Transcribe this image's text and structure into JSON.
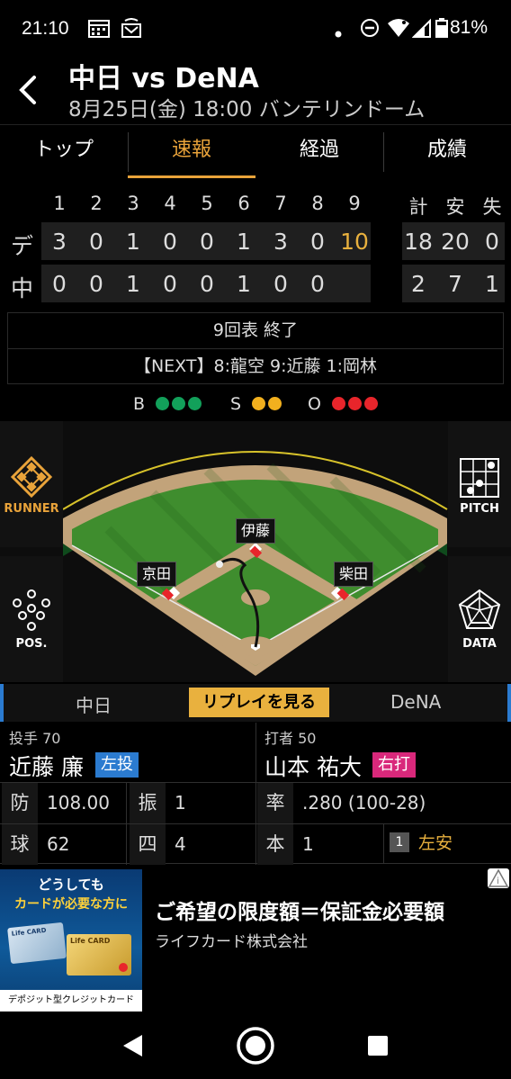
{
  "status_bar": {
    "time": "21:10",
    "battery": "81%",
    "icons": [
      "calendar-icon",
      "cast-icon",
      "dot-icon",
      "dnd-icon",
      "wifi-icon",
      "signal-icon",
      "battery-icon"
    ]
  },
  "header": {
    "title": "中日 vs DeNA",
    "subtitle": "8月25日(金) 18:00 バンテリンドーム"
  },
  "tabs": [
    {
      "label": "トップ",
      "active": false
    },
    {
      "label": "速報",
      "active": true
    },
    {
      "label": "経過",
      "active": false
    },
    {
      "label": "成績",
      "active": false
    }
  ],
  "scoreboard": {
    "innings": [
      "1",
      "2",
      "3",
      "4",
      "5",
      "6",
      "7",
      "8",
      "9"
    ],
    "totals_headers": [
      "計",
      "安",
      "失"
    ],
    "teams": [
      {
        "name": "デ",
        "runs": [
          "3",
          "0",
          "1",
          "0",
          "0",
          "1",
          "3",
          "0",
          "10"
        ],
        "totals": [
          "18",
          "20",
          "0"
        ]
      },
      {
        "name": "中",
        "runs": [
          "0",
          "0",
          "1",
          "0",
          "0",
          "1",
          "0",
          "0",
          ""
        ],
        "totals": [
          "2",
          "7",
          "1"
        ]
      }
    ]
  },
  "game_status": {
    "state": "9回表 終了",
    "next": "【NEXT】8:龍空 9:近藤 1:岡林"
  },
  "count": {
    "balls_label": "B",
    "strikes_label": "S",
    "outs_label": "O",
    "balls": 3,
    "strikes": 2,
    "outs": 3,
    "colors": {
      "ball": "#12a05a",
      "strike": "#f2b01e",
      "out": "#e8252b"
    }
  },
  "field": {
    "runner_label": "RUNNER",
    "pitch_label": "PITCH",
    "pos_label": "POS.",
    "data_label": "DATA",
    "fielders": [
      {
        "name": "伊藤"
      },
      {
        "name": "京田"
      },
      {
        "name": "柴田"
      }
    ]
  },
  "matchup": {
    "home_team": "中日",
    "replay_label": "リプレイを見る",
    "away_team": "DeNA",
    "pitcher": {
      "role": "投手 70",
      "name": "近藤 廉",
      "hand": "左投",
      "hand_color": "#2b7bd0"
    },
    "batter": {
      "role": "打者 50",
      "name": "山本 祐大",
      "hand": "右打",
      "hand_color": "#d9287b"
    },
    "pitcher_stats": [
      {
        "label": "防",
        "value": "108.00"
      },
      {
        "label": "振",
        "value": "1"
      },
      {
        "label": "球",
        "value": "62"
      },
      {
        "label": "四",
        "value": "4"
      }
    ],
    "batter_stats": [
      {
        "label": "率",
        "value": ".280 (100-28)"
      },
      {
        "label": "本",
        "value": "1"
      }
    ],
    "result": {
      "number": "1",
      "text": "左安"
    }
  },
  "ad": {
    "headline": "ご希望の限度額＝保証金必要額",
    "company": "ライフカード株式会社",
    "image_text_1": "どうしても",
    "image_text_2": "カードが必要な方に",
    "image_text_3": "デポジット型クレジットカード",
    "card_label": "Life CARD"
  },
  "nav": {
    "icons": [
      "back-icon",
      "home-icon",
      "recents-icon"
    ]
  }
}
